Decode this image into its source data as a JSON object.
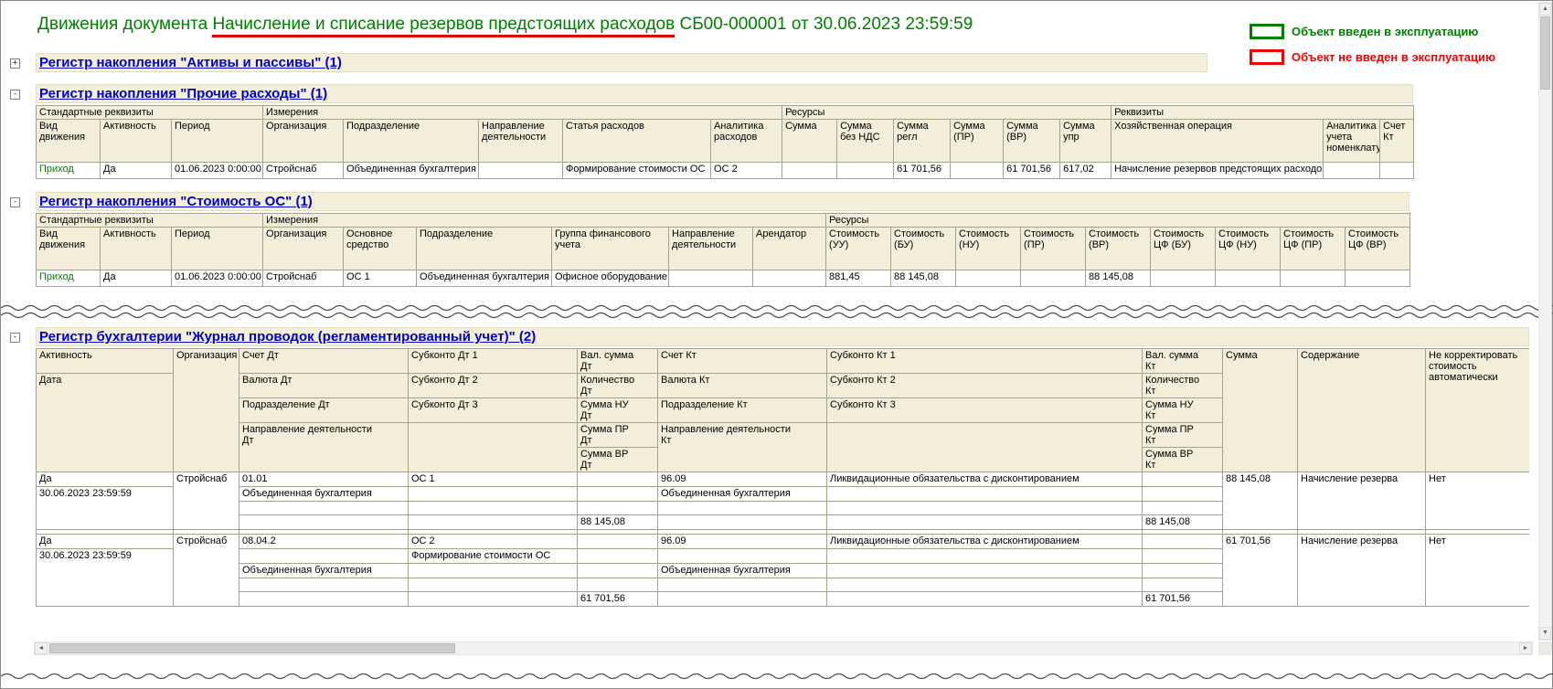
{
  "title": {
    "prefix": "Движения документа ",
    "highlight": "Начисление и списание резервов предстоящих расходов",
    "suffix": " СБ00-000001 от 30.06.2023 23:59:59",
    "highlight_underline_color": "#e00000",
    "text_color": "#008000"
  },
  "legend": {
    "items": [
      {
        "label": "Объект введен в эксплуатацию",
        "color": "#008000"
      },
      {
        "label": "Объект не введен в эксплуатацию",
        "color": "#ff0000"
      }
    ]
  },
  "icons": {
    "up": "▲",
    "down": "▼",
    "left": "◄",
    "right": "►"
  },
  "sections": {
    "assets": {
      "toggle": "+",
      "title": "Регистр накопления \"Активы и пассивы\" (1)"
    },
    "other": {
      "toggle": "-",
      "title": "Регистр накопления \"Прочие расходы\" (1)",
      "table": {
        "header": [
          [
            {
              "t": "Стандартные реквизиты",
              "cs": 3
            },
            {
              "t": "Измерения",
              "cs": 5
            },
            {
              "t": "Ресурсы",
              "cs": 6
            },
            {
              "t": "Реквизиты",
              "cs": 3
            }
          ],
          [
            {
              "t": "Вид\nдвижения"
            },
            {
              "t": "Активность"
            },
            {
              "t": "Период"
            },
            {
              "t": "Организация"
            },
            {
              "t": "Подразделение"
            },
            {
              "t": "Направление деятельности"
            },
            {
              "t": "Статья расходов"
            },
            {
              "t": "Аналитика расходов"
            },
            {
              "t": "Сумма"
            },
            {
              "t": "Сумма\nбез НДС"
            },
            {
              "t": "Сумма\nрегл"
            },
            {
              "t": "Сумма\n(ПР)"
            },
            {
              "t": "Сумма\n(ВР)"
            },
            {
              "t": "Сумма\nупр"
            },
            {
              "t": "Хозяйственная операция"
            },
            {
              "t": "Аналитика\nучета\nноменклатуры"
            },
            {
              "t": "Счет\nКт"
            }
          ]
        ],
        "body": [
          [
            {
              "t": "Приход",
              "c": "green",
              "ind": 1,
              "hl": "r:tl"
            },
            {
              "t": "Да",
              "hl": "r:tb"
            },
            {
              "t": "01.06.2023 0:00:00",
              "hl": "r:tb"
            },
            {
              "t": "Стройснаб",
              "hl": "r:tb"
            },
            {
              "t": "Объединенная бухгалтерия",
              "hl": "r:tb"
            },
            {
              "t": "",
              "hl": "r:tb"
            },
            {
              "t": "Формирование стоимости ОС",
              "hl": "r:tb"
            },
            {
              "t": "ОС 2",
              "hl": "r:tb"
            },
            {
              "t": "",
              "hl": "r:tb"
            },
            {
              "t": "",
              "hl": "r:tb"
            },
            {
              "t": "61 701,56",
              "a": "r",
              "hl": "r:tb"
            },
            {
              "t": "",
              "hl": "r:tb"
            },
            {
              "t": "61 701,56",
              "a": "r",
              "hl": "r:tb"
            },
            {
              "t": "617,02",
              "a": "r",
              "hl": "r:tb"
            },
            {
              "t": "Начисление резервов предстоящих расходов",
              "hl": "r:tb"
            },
            {
              "t": "",
              "hl": "r:tb"
            },
            {
              "t": "",
              "hl": "r:tbr"
            }
          ]
        ]
      }
    },
    "cost": {
      "toggle": "-",
      "title": "Регистр накопления \"Стоимость ОС\" (1)",
      "table": {
        "header": [
          [
            {
              "t": "Стандартные реквизиты",
              "cs": 3
            },
            {
              "t": "Измерения",
              "cs": 6
            },
            {
              "t": "Ресурсы",
              "cs": 9
            }
          ],
          [
            {
              "t": "Вид\nдвижения"
            },
            {
              "t": "Активность"
            },
            {
              "t": "Период"
            },
            {
              "t": "Организация"
            },
            {
              "t": "Основное\nсредство"
            },
            {
              "t": "Подразделение"
            },
            {
              "t": "Группа финансового\nучета"
            },
            {
              "t": "Направление деятельности"
            },
            {
              "t": "Арендатор"
            },
            {
              "t": "Стоимость\n(УУ)"
            },
            {
              "t": "Стоимость\n(БУ)"
            },
            {
              "t": "Стоимость\n(НУ)"
            },
            {
              "t": "Стоимость\n(ПР)"
            },
            {
              "t": "Стоимость\n(ВР)"
            },
            {
              "t": "Стоимость\nЦФ (БУ)"
            },
            {
              "t": "Стоимость\nЦФ (НУ)"
            },
            {
              "t": "Стоимость\nЦФ (ПР)"
            },
            {
              "t": "Стоимость\nЦФ (ВР)"
            }
          ]
        ],
        "body": [
          [
            {
              "t": "Приход",
              "c": "green",
              "ind": 1,
              "hl": "g:tl"
            },
            {
              "t": "Да",
              "hl": "g:tb"
            },
            {
              "t": "01.06.2023 0:00:00",
              "hl": "g:tb"
            },
            {
              "t": "Стройснаб",
              "hl": "g:tb"
            },
            {
              "t": "ОС 1",
              "hl": "g:tb"
            },
            {
              "t": "Объединенная бухгалтерия",
              "hl": "g:tb"
            },
            {
              "t": "Офисное оборудование",
              "hl": "g:tb"
            },
            {
              "t": "",
              "hl": "g:tb"
            },
            {
              "t": "",
              "hl": "g:tb"
            },
            {
              "t": "881,45",
              "a": "r",
              "hl": "g:tb"
            },
            {
              "t": "88 145,08",
              "a": "r",
              "hl": "g:tb"
            },
            {
              "t": "",
              "hl": "g:tb"
            },
            {
              "t": "",
              "hl": "g:tb"
            },
            {
              "t": "88 145,08",
              "a": "r",
              "hl": "g:tb"
            },
            {
              "t": "",
              "hl": "g:tb"
            },
            {
              "t": "",
              "hl": "g:tb"
            },
            {
              "t": "",
              "hl": "g:tb"
            },
            {
              "t": "",
              "hl": "g:tbr"
            }
          ]
        ]
      }
    },
    "journal": {
      "toggle": "-",
      "title": "Регистр бухгалтерии \"Журнал проводок (регламентированный учет)\" (2)",
      "table": {
        "header": [
          [
            {
              "t": "Активность"
            },
            {
              "t": "Организация",
              "rs": 5
            },
            {
              "t": "Счет Дт"
            },
            {
              "t": "Субконто Дт 1"
            },
            {
              "t": "Вал. сумма\nДт"
            },
            {
              "t": "Счет Кт"
            },
            {
              "t": "Субконто Кт 1"
            },
            {
              "t": "Вал. сумма\nКт"
            },
            {
              "t": "Сумма",
              "rs": 5
            },
            {
              "t": "Содержание",
              "rs": 5
            },
            {
              "t": "Не корректировать\nстоимость\nавтоматически",
              "rs": 5
            }
          ],
          [
            {
              "t": "Дата",
              "rs": 4
            },
            {
              "t": "Валюта Дт"
            },
            {
              "t": "Субконто Дт 2"
            },
            {
              "t": "Количество\nДт"
            },
            {
              "t": "Валюта Кт"
            },
            {
              "t": "Субконто Кт 2"
            },
            {
              "t": "Количество\nКт"
            }
          ],
          [
            {
              "t": "Подразделение Дт"
            },
            {
              "t": "Субконто Дт 3"
            },
            {
              "t": "Сумма НУ\nДт"
            },
            {
              "t": "Подразделение Кт"
            },
            {
              "t": "Субконто Кт 3"
            },
            {
              "t": "Сумма НУ\nКт"
            }
          ],
          [
            {
              "t": "Направление деятельности\nДт",
              "rs": 2
            },
            {
              "t": "",
              "rs": 2
            },
            {
              "t": "Сумма ПР\nДт"
            },
            {
              "t": "Направление деятельности\nКт",
              "rs": 2
            },
            {
              "t": "",
              "rs": 2
            },
            {
              "t": "Сумма ПР\nКт"
            }
          ],
          [
            {
              "t": "Сумма ВР\nДт"
            },
            {
              "t": "Сумма ВР\nКт"
            }
          ]
        ],
        "body": [
          [
            {
              "t": "Да",
              "ind": 1
            },
            {
              "t": "Стройснаб",
              "rs": 4
            },
            {
              "t": "01.01",
              "hl": "g:tl"
            },
            {
              "t": "ОС 1",
              "hl": "g:t"
            },
            {
              "t": "",
              "hl": "g:t"
            },
            {
              "t": "96.09",
              "hl": "g:t"
            },
            {
              "t": "Ликвидационные обязательства с дисконтированием",
              "hl": "g:t"
            },
            {
              "t": "",
              "hl": "g:tr"
            },
            {
              "t": "88 145,08",
              "rs": 4,
              "a": "r"
            },
            {
              "t": "Начисление резерва",
              "rs": 4
            },
            {
              "t": "Нет",
              "rs": 4
            }
          ],
          [
            {
              "t": "30.06.2023 23:59:59",
              "rs": 3
            },
            {
              "t": "Объединенная бухгалтерия",
              "hl": "g:l"
            },
            {
              "t": ""
            },
            {
              "t": ""
            },
            {
              "t": "Объединенная бухгалтерия"
            },
            {
              "t": ""
            },
            {
              "t": "",
              "hl": "g:r"
            }
          ],
          [
            {
              "t": "",
              "hl": "g:l"
            },
            {
              "t": ""
            },
            {
              "t": ""
            },
            {
              "t": ""
            },
            {
              "t": ""
            },
            {
              "t": "",
              "hl": "g:r"
            }
          ],
          [
            {
              "t": "",
              "hl": "g:lb"
            },
            {
              "t": "",
              "hl": "g:b"
            },
            {
              "t": "88 145,08",
              "a": "r",
              "hl": "g:b"
            },
            {
              "t": "",
              "hl": "g:b"
            },
            {
              "t": "",
              "hl": "g:b"
            },
            {
              "t": "88 145,08",
              "a": "r",
              "hl": "g:br"
            }
          ],
          [
            {
              "t": ""
            },
            {
              "t": ""
            },
            {
              "t": ""
            },
            {
              "t": ""
            },
            {
              "t": ""
            },
            {
              "t": ""
            },
            {
              "t": ""
            },
            {
              "t": ""
            },
            {
              "t": ""
            },
            {
              "t": ""
            },
            {
              "t": ""
            }
          ],
          [
            {
              "t": "Да",
              "ind": 1
            },
            {
              "t": "Стройснаб",
              "rs": 5
            },
            {
              "t": "08.04.2",
              "hl": "r:tl"
            },
            {
              "t": "ОС 2",
              "hl": "r:t"
            },
            {
              "t": "",
              "hl": "r:t"
            },
            {
              "t": "96.09",
              "hl": "r:t"
            },
            {
              "t": "Ликвидационные обязательства с дисконтированием",
              "hl": "r:t"
            },
            {
              "t": "",
              "hl": "r:tr"
            },
            {
              "t": "61 701,56",
              "rs": 5,
              "a": "r"
            },
            {
              "t": "Начисление резерва",
              "rs": 5
            },
            {
              "t": "Нет",
              "rs": 5
            }
          ],
          [
            {
              "t": "30.06.2023 23:59:59",
              "rs": 4
            },
            {
              "t": "",
              "hl": "r:l"
            },
            {
              "t": "Формирование стоимости ОС"
            },
            {
              "t": ""
            },
            {
              "t": ""
            },
            {
              "t": ""
            },
            {
              "t": "",
              "hl": "r:r"
            }
          ],
          [
            {
              "t": "Объединенная бухгалтерия",
              "hl": "r:l"
            },
            {
              "t": ""
            },
            {
              "t": ""
            },
            {
              "t": "Объединенная бухгалтерия"
            },
            {
              "t": ""
            },
            {
              "t": "",
              "hl": "r:r"
            }
          ],
          [
            {
              "t": "",
              "hl": "r:l"
            },
            {
              "t": ""
            },
            {
              "t": ""
            },
            {
              "t": ""
            },
            {
              "t": ""
            },
            {
              "t": "",
              "hl": "r:r"
            }
          ],
          [
            {
              "t": "",
              "hl": "r:lb"
            },
            {
              "t": "",
              "hl": "r:b"
            },
            {
              "t": "61 701,56",
              "a": "r",
              "hl": "r:b"
            },
            {
              "t": "",
              "hl": "r:b"
            },
            {
              "t": "",
              "hl": "r:b"
            },
            {
              "t": "61 701,56",
              "a": "r",
              "hl": "r:br"
            }
          ]
        ]
      }
    }
  }
}
